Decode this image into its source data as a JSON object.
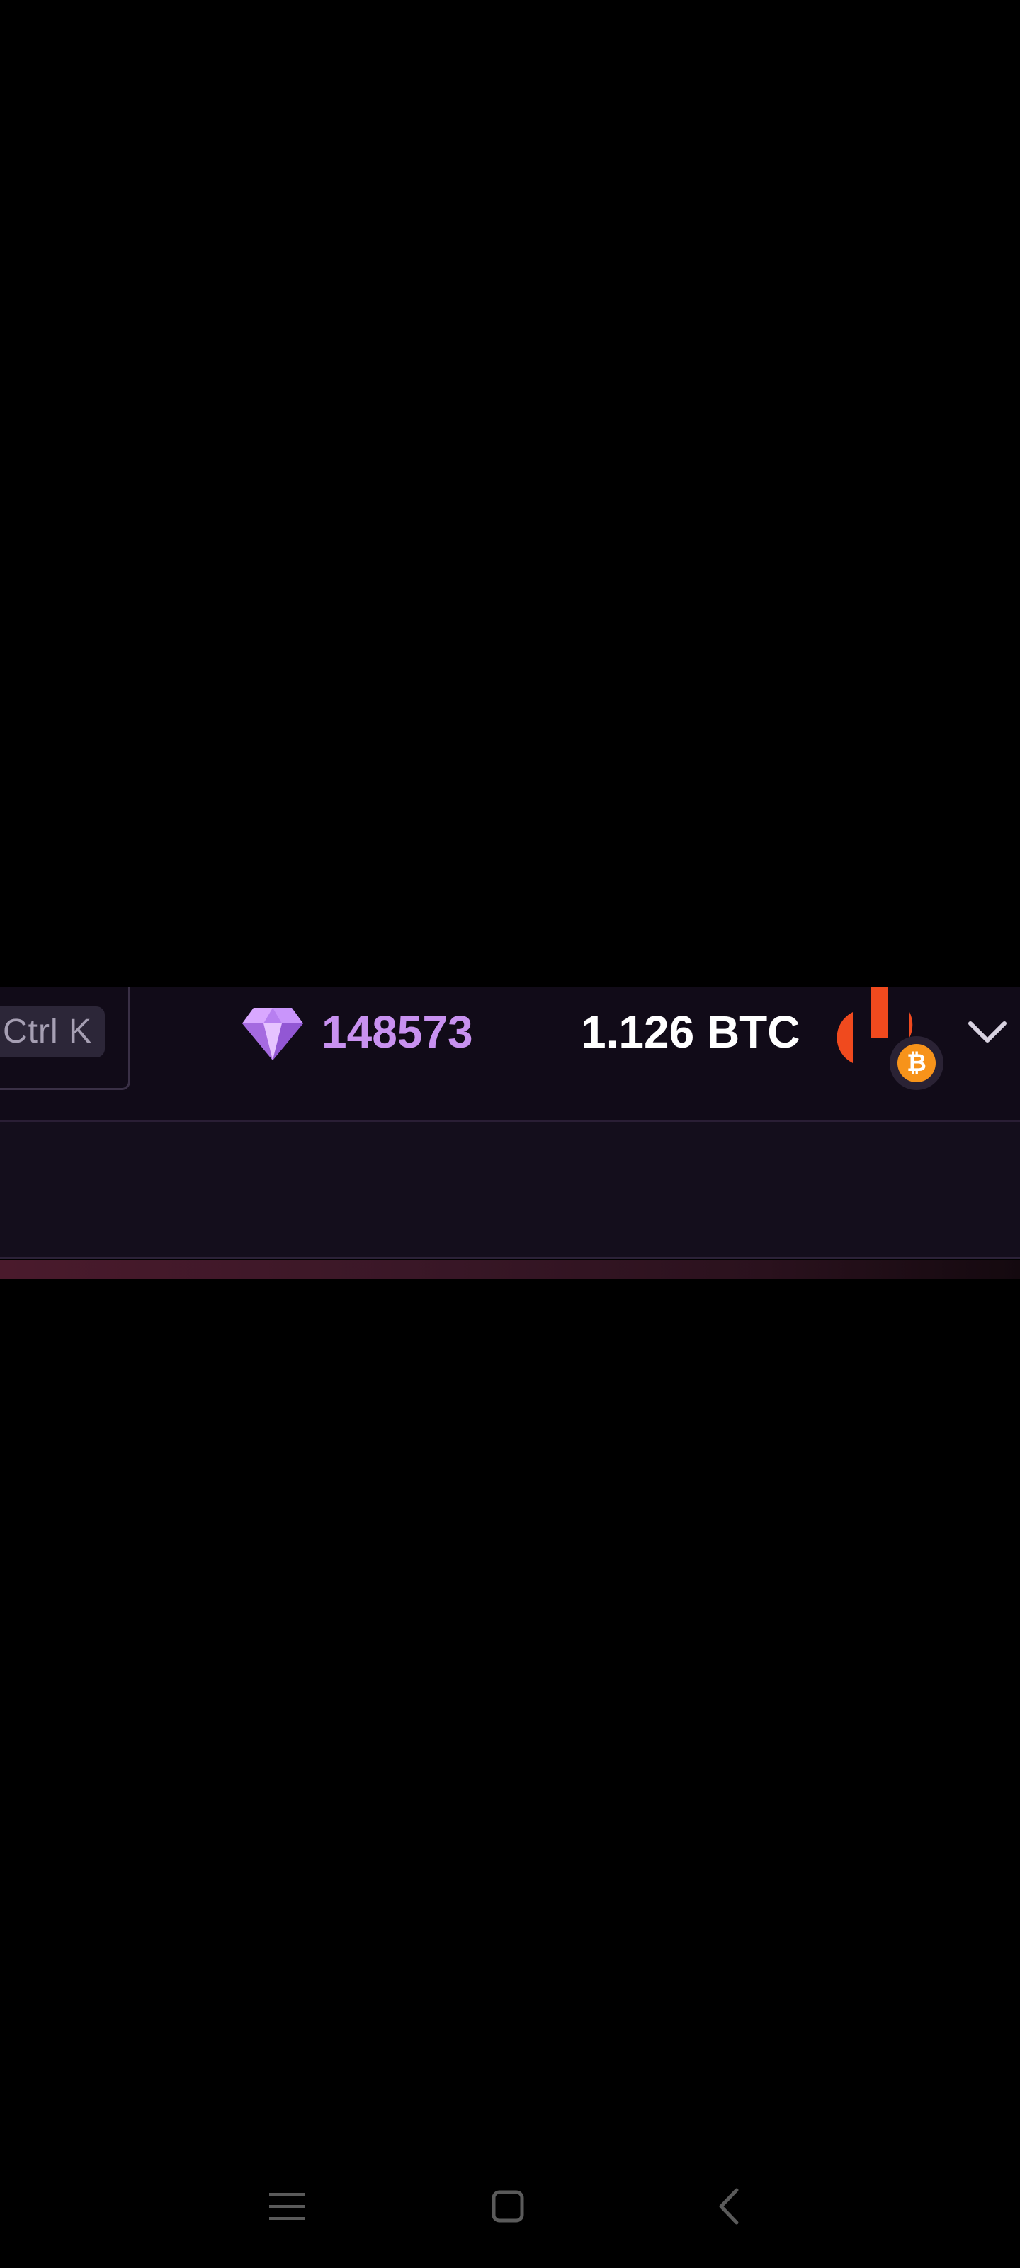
{
  "header": {
    "search_shortcut": "Ctrl K",
    "gems": {
      "icon": "diamond-icon",
      "count": "148573",
      "color": "#c891f0"
    },
    "balance": {
      "text": "1.126 BTC"
    },
    "avatar": {
      "icon": "user-avatar",
      "currency_badge": "bitcoin-icon",
      "badge_symbol": "₿",
      "badge_color": "#f7931a",
      "avatar_color": "#f04a1e"
    },
    "account_menu_icon": "chevron-down-icon"
  },
  "android_nav": {
    "menu_icon": "recent-apps-icon",
    "home_icon": "home-icon",
    "back_icon": "back-icon"
  }
}
